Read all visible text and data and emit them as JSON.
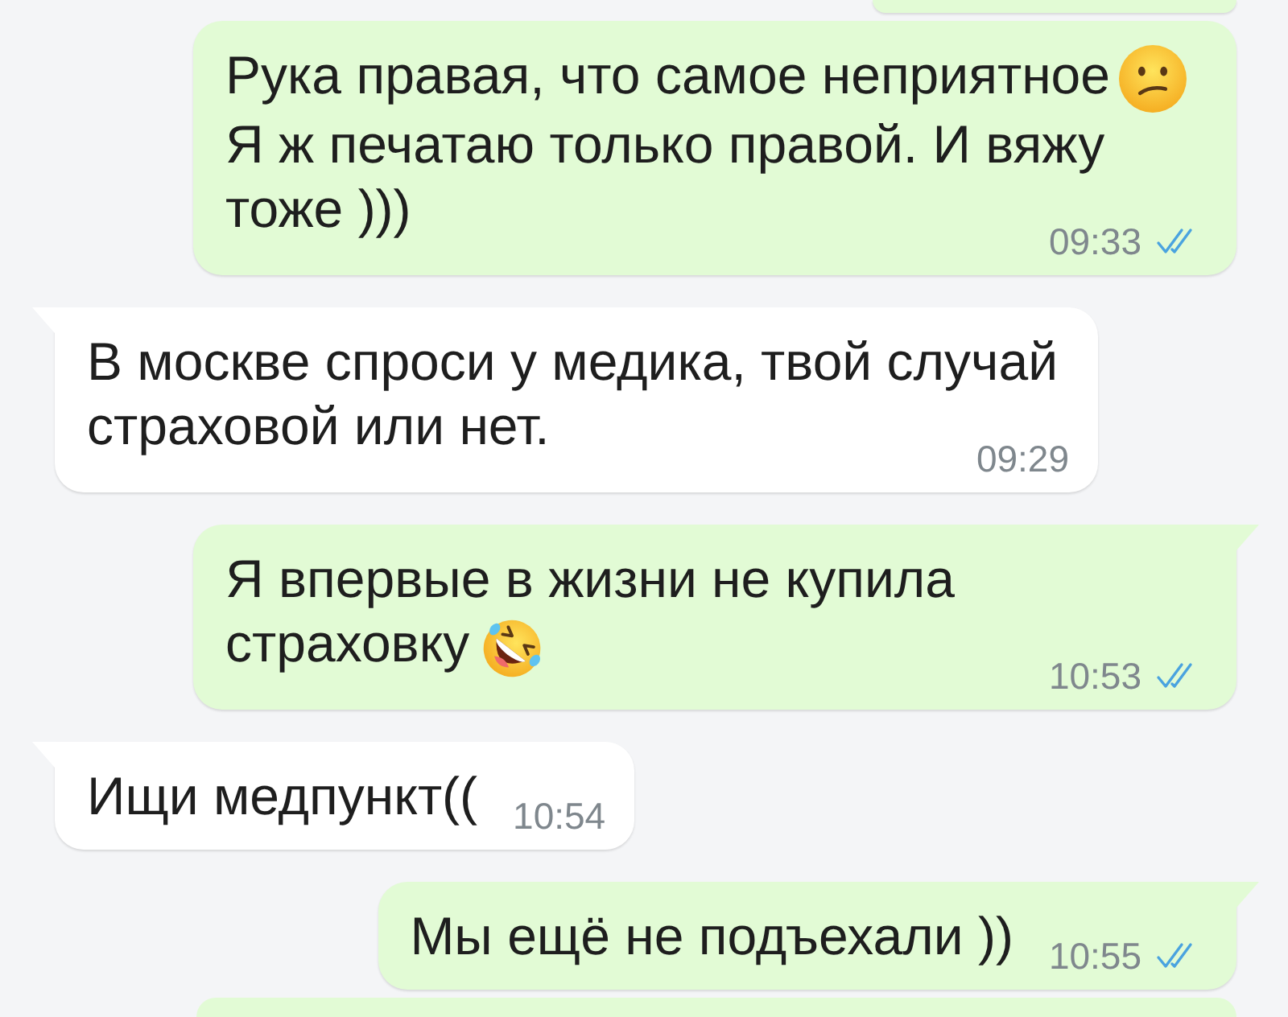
{
  "cut_off_above": {
    "kind": "outgoing"
  },
  "messages": [
    {
      "kind": "outgoing",
      "tail": false,
      "paragraphs": [
        {
          "text": "Рука правая, что самое неприятное",
          "emoji": {
            "kind": "confused-face"
          }
        },
        {
          "text": "Я ж печатаю только правой. И вяжу тоже )))"
        }
      ],
      "time": "09:33",
      "read": true
    },
    {
      "kind": "incoming",
      "tail": true,
      "paragraphs": [
        {
          "text": "В москве спроси у медика, твой случай страховой или нет."
        }
      ],
      "time": "09:29"
    },
    {
      "kind": "outgoing",
      "tail": true,
      "paragraphs": [
        {
          "text": "Я впервые в жизни не купила страховку",
          "emoji": {
            "kind": "rolling-laughing-face"
          }
        }
      ],
      "time": "10:53",
      "read": true
    },
    {
      "kind": "incoming",
      "tail": true,
      "paragraphs": [
        {
          "text": "Ищи медпункт(("
        }
      ],
      "time": "10:54"
    },
    {
      "kind": "outgoing",
      "tail": true,
      "paragraphs": [
        {
          "text": "Мы ещё не подъехали ))"
        }
      ],
      "time": "10:55",
      "read": true
    }
  ],
  "cut_off_below": {
    "kind": "outgoing"
  }
}
